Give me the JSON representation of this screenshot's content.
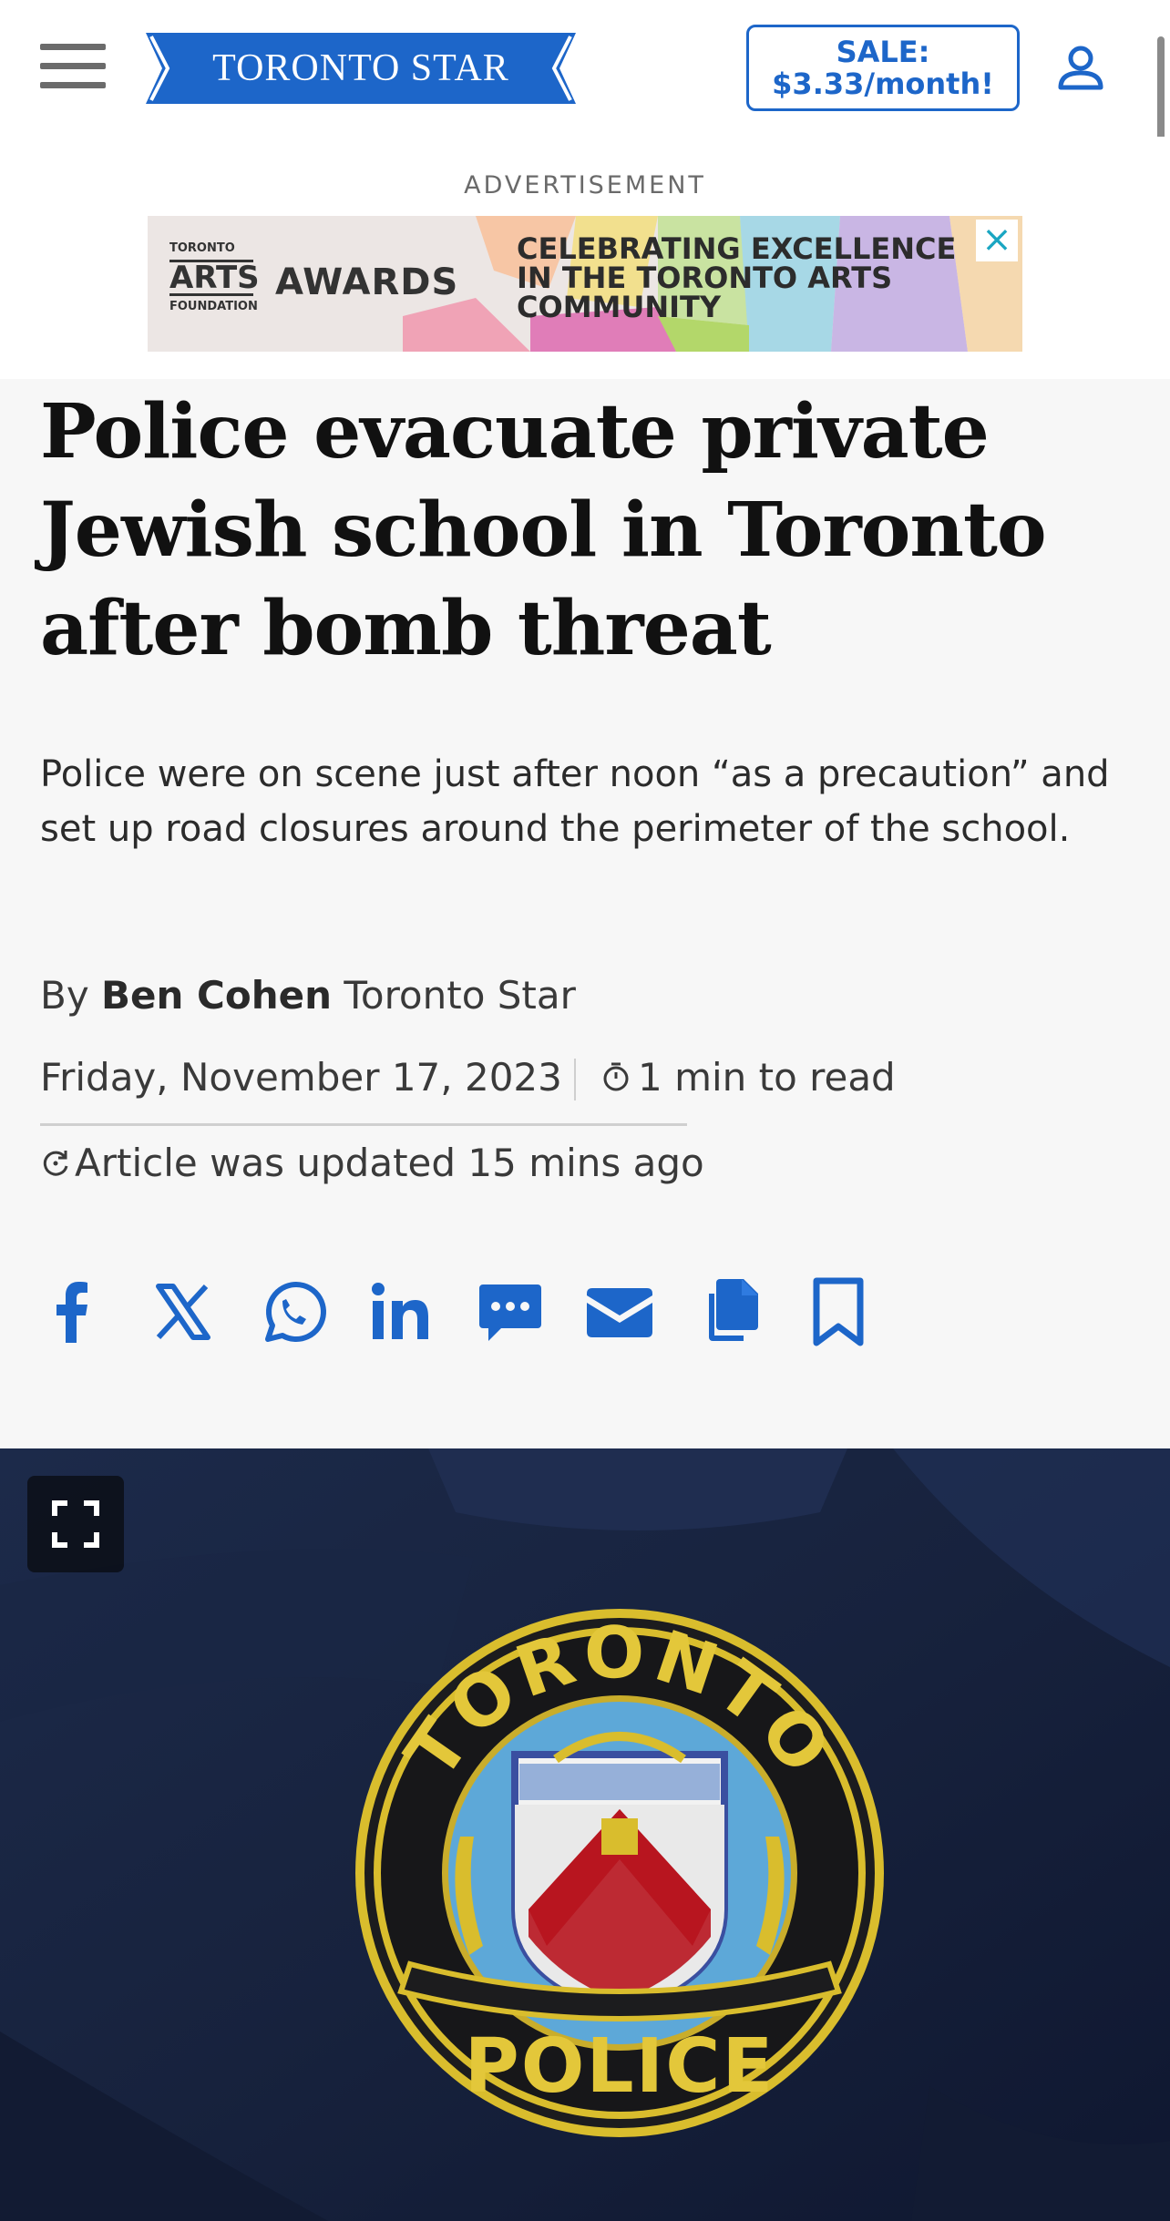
{
  "header": {
    "logo_text": "TORONTO STAR",
    "sale_line1": "SALE:",
    "sale_line2": "$3.33/month!",
    "brand_color": "#1d66c9"
  },
  "ad": {
    "label": "ADVERTISEMENT",
    "org_small_top": "TORONTO",
    "org_big": "ARTS",
    "org_small_bottom": "FOUNDATION",
    "awards": "AWARDS",
    "headline_lines": [
      "CELEBRATING EXCELLENCE",
      "IN THE TORONTO ARTS",
      "COMMUNITY"
    ],
    "close_symbol": "×"
  },
  "article": {
    "headline": "Police evacuate private Jewish school in Toronto after bomb threat",
    "dek": "Police were on scene just after noon “as a precaution” and set up road closures around the perimeter of the school.",
    "by_prefix": "By",
    "author": "Ben Cohen",
    "publication": "Toronto Star",
    "date": "Friday, November 17, 2023",
    "read_time": "1 min to read",
    "updated": "Article was updated 15 mins ago"
  },
  "share_icons": [
    "facebook-icon",
    "x-icon",
    "whatsapp-icon",
    "linkedin-icon",
    "sms-icon",
    "email-icon",
    "copy-icon",
    "bookmark-icon"
  ],
  "hero": {
    "patch_top_text": "TORONTO",
    "patch_bottom_text": "POLICE"
  }
}
